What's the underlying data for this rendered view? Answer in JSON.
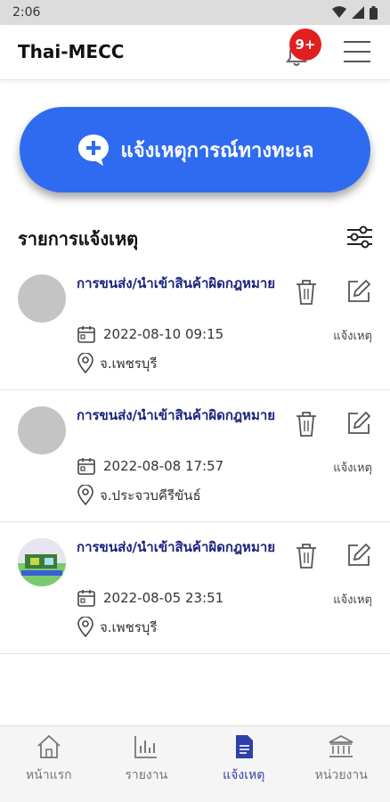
{
  "status_bar": {
    "time": "2:06"
  },
  "app_bar": {
    "title": "Thai-MECC",
    "notification_badge": "9+"
  },
  "report_button": {
    "label": "แจ้งเหตุการณ์ทางทะเล",
    "icon": "add-comment-icon",
    "color": "#2f6bf1"
  },
  "section": {
    "title": "รายการแจ้งเหตุ"
  },
  "reports": [
    {
      "title": "การขนส่ง/นำเข้าสินค้าผิดกฎหมาย",
      "datetime": "2022-08-10 09:15",
      "location": "จ.เพชรบุรี",
      "status": "แจ้งเหตุ"
    },
    {
      "title": "การขนส่ง/นำเข้าสินค้าผิดกฎหมาย",
      "datetime": "2022-08-08 17:57",
      "location": "จ.ประจวบคีรีขันธ์",
      "status": "แจ้งเหตุ"
    },
    {
      "title": "การขนส่ง/นำเข้าสินค้าผิดกฎหมาย",
      "datetime": "2022-08-05 23:51",
      "location": "จ.เพชรบุรี",
      "status": "แจ้งเหตุ"
    }
  ],
  "bottom_nav": [
    {
      "label": "หน้าแรก",
      "icon": "home-icon"
    },
    {
      "label": "รายงาน",
      "icon": "bar-chart-icon"
    },
    {
      "label": "แจ้งเหตุ",
      "icon": "document-icon",
      "active": true
    },
    {
      "label": "หน่วยงาน",
      "icon": "bank-icon"
    }
  ],
  "colors": {
    "accent": "#2f6bf1",
    "title_text": "#1a237e",
    "badge": "#e02020"
  }
}
